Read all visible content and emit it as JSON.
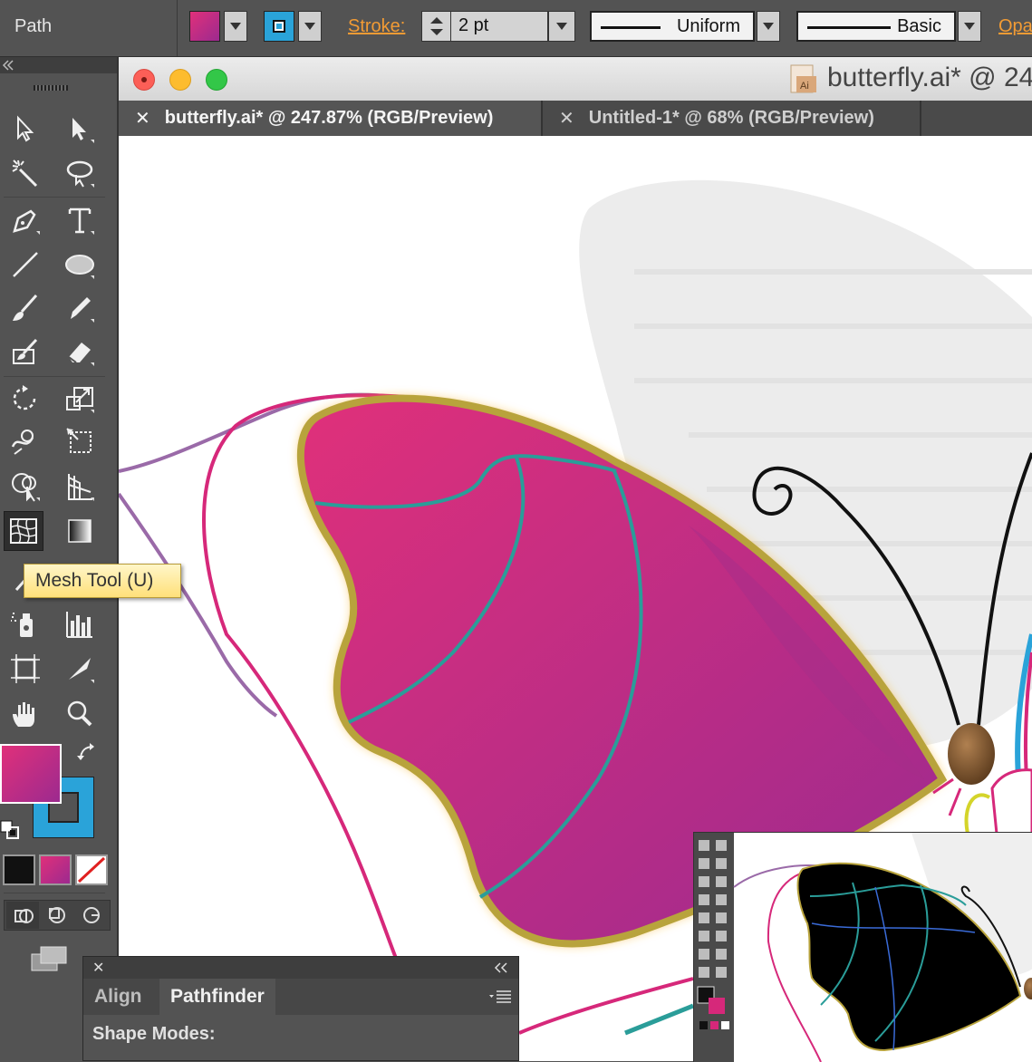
{
  "control_bar": {
    "selection_label": "Path",
    "fill_color": "#d6287a",
    "stroke_color": "#2aa3d9",
    "stroke_label": "Stroke:",
    "stroke_weight": "2 pt",
    "profile_label": "Uniform",
    "brush_label": "Basic",
    "opacity_label": "Opa"
  },
  "document": {
    "title": "butterfly.ai* @ 24",
    "tabs": [
      {
        "label": "butterfly.ai* @ 247.87% (RGB/Preview)",
        "active": true
      },
      {
        "label": "Untitled-1* @ 68% (RGB/Preview)",
        "active": false
      }
    ]
  },
  "tooltip": {
    "text": "Mesh Tool (U)"
  },
  "pathfinder_panel": {
    "tabs": [
      "Align",
      "Pathfinder"
    ],
    "active_tab": "Pathfinder",
    "section_label": "Shape Modes:"
  },
  "colors": {
    "accent_orange": "#f29b34",
    "wing_magenta": "#d6287a",
    "wing_purple": "#a12d8f",
    "mesh_teal": "#2a9d99",
    "glow_yellow": "#f7b32b"
  }
}
